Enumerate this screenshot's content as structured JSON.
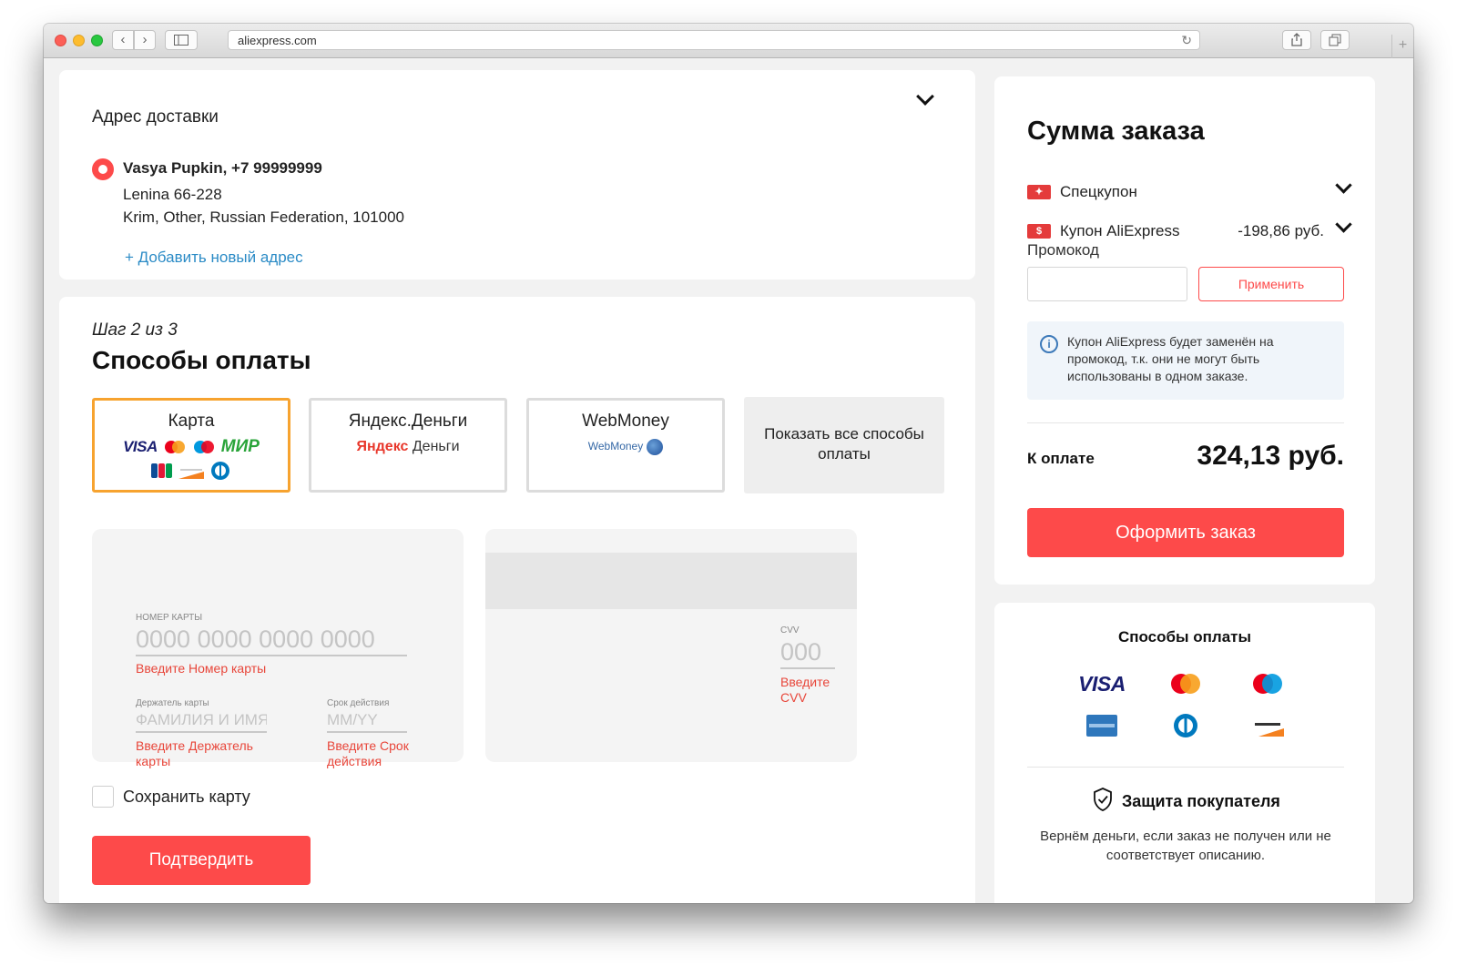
{
  "browser": {
    "url": "aliexpress.com"
  },
  "address": {
    "title": "Адрес доставки",
    "name": "Vasya Pupkin, +7 99999999",
    "line1": "Lenina 66-228",
    "line2": "Krim, Other, Russian Federation, 101000",
    "add_label": "+ Добавить новый адрес"
  },
  "payment": {
    "step": "Шаг 2 из 3",
    "heading": "Способы оплаты",
    "methods": [
      {
        "label": "Карта"
      },
      {
        "label": "Яндекс.Деньги",
        "logo_a": "Яндекс",
        "logo_b": "Деньги"
      },
      {
        "label": "WebMoney",
        "logo": "WebMoney"
      },
      {
        "label": "Показать все способы оплаты"
      }
    ],
    "card_logos": [
      "VISA",
      "МИР"
    ],
    "card_number_label": "НОМЕР КАРТЫ",
    "card_number_placeholder": "0000 0000 0000 0000",
    "card_number_error": "Введите Номер карты",
    "holder_label": "Держатель карты",
    "holder_placeholder": "ФАМИЛИЯ И ИМЯ",
    "holder_error": "Введите Держатель карты",
    "expiry_label": "Срок действия",
    "expiry_placeholder": "MM/YY",
    "expiry_error": "Введите Срок действия",
    "cvv_label": "CVV",
    "cvv_placeholder": "000",
    "cvv_error": "Введите CVV",
    "save_card": "Сохранить карту",
    "confirm": "Подтвердить"
  },
  "summary": {
    "title": "Сумма заказа",
    "coupons": [
      {
        "label": "Спецкупон",
        "amount": ""
      },
      {
        "label": "Купон AliExpress",
        "amount": "-198,86 руб."
      }
    ],
    "promo_label": "Промокод",
    "apply": "Применить",
    "notice": "Купон AliExpress будет заменён на промокод, т.к. они не могут быть использованы в одном заказе.",
    "to_pay_label": "К оплате",
    "to_pay_amount": "324,13 руб.",
    "order_button": "Оформить заказ"
  },
  "payment_info": {
    "title": "Способы оплаты",
    "logos": [
      "VISA",
      "mastercard",
      "maestro",
      "american express",
      "diners club",
      "discover"
    ],
    "protection_title": "Защита покупателя",
    "protection_text": "Вернём деньги, если заказ не получен или не соответствует описанию."
  },
  "colors": {
    "accent": "#fd4a4a",
    "link": "#2b8bc6",
    "selected_border": "#f7a32f",
    "error": "#e8463a"
  }
}
